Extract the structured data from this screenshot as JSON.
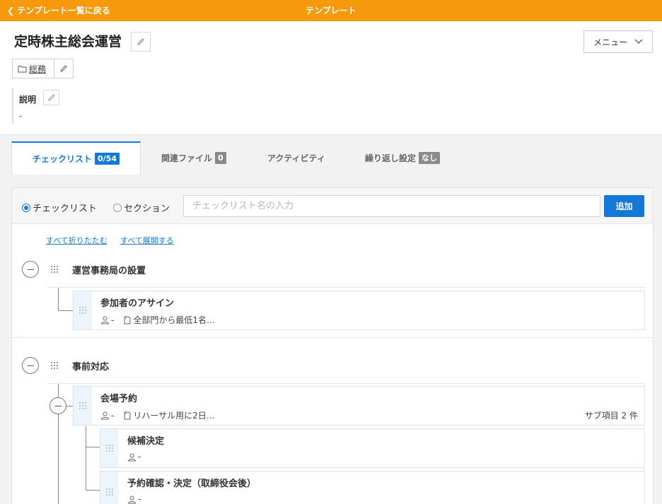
{
  "topbar": {
    "back_label": "テンプレート一覧に戻る",
    "center_title": "テンプレート",
    "color": "#f7990c"
  },
  "template": {
    "title": "定時株主総会運営",
    "folder": "総務",
    "description_label": "説明",
    "description_value": "-"
  },
  "menu": {
    "label": "メニュー"
  },
  "tabs": [
    {
      "label": "チェックリスト",
      "badge": "0/54",
      "active": true
    },
    {
      "label": "関連ファイル",
      "badge": "0"
    },
    {
      "label": "アクティビティ"
    },
    {
      "label": "繰り返し設定",
      "badge": "なし"
    }
  ],
  "add_form": {
    "radio_checklist": "チェックリスト",
    "radio_section": "セクション",
    "selected": "チェックリスト",
    "placeholder": "チェックリスト名の入力",
    "add_label": "追加"
  },
  "links": {
    "collapse_all": "すべて折りたたむ",
    "expand_all": "すべて展開する"
  },
  "sections": [
    {
      "name": "運営事務局の設置",
      "items": [
        {
          "name": "参加者のアサイン",
          "assignee": "-",
          "note": "全部門から最低1名…"
        }
      ]
    },
    {
      "name": "事前対応",
      "items": [
        {
          "name": "会場予約",
          "assignee": "-",
          "note": "リハーサル用に2日…",
          "sub_count_label": "サブ項目 2 件",
          "subitems": [
            {
              "name": "候補決定",
              "assignee": "-"
            },
            {
              "name": "予約確認・決定（取締役会後）",
              "assignee": "-"
            }
          ]
        }
      ]
    }
  ]
}
